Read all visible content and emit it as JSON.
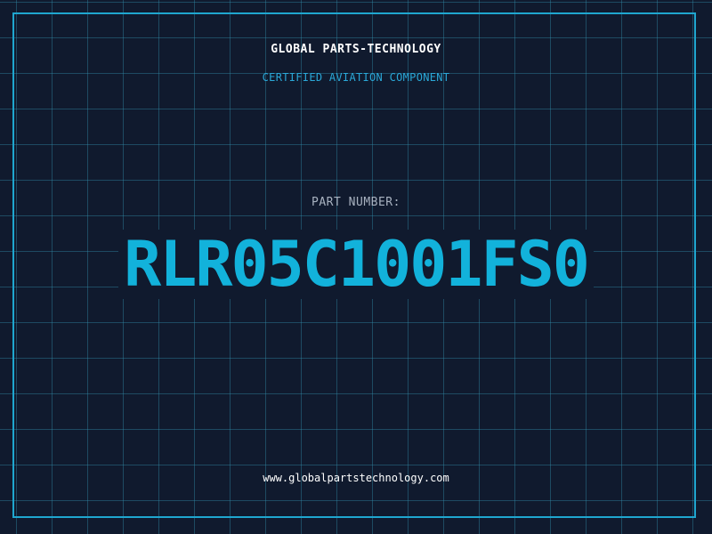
{
  "header": {
    "company": "GLOBAL PARTS-TECHNOLOGY",
    "subtitle": "CERTIFIED AVIATION COMPONENT"
  },
  "part": {
    "label": "PART NUMBER:",
    "number": "RLR05C1001FS0"
  },
  "footer": {
    "website": "www.globalpartstechnology.com"
  },
  "colors": {
    "background": "#101a2e",
    "grid": "#328caa",
    "border": "#1fa6cf",
    "accent": "#12b2db",
    "label": "#a8b2c0",
    "text": "#ffffff"
  }
}
